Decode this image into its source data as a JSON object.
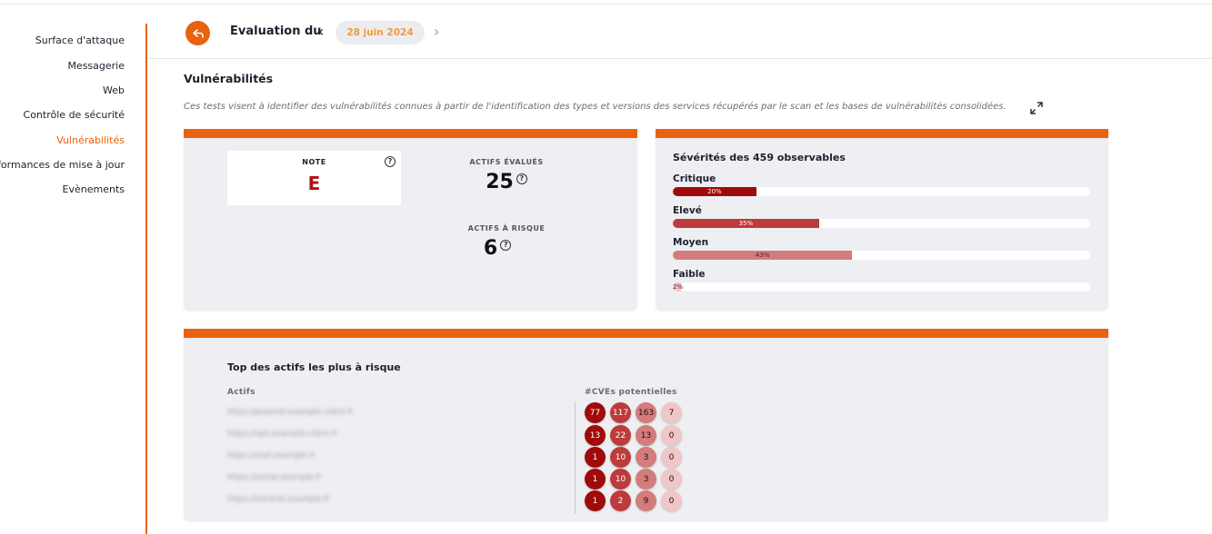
{
  "sidebar": {
    "items": [
      {
        "label": "Surface d'attaque",
        "active": false
      },
      {
        "label": "Messagerie",
        "active": false
      },
      {
        "label": "Web",
        "active": false
      },
      {
        "label": "Contrôle de sécurité",
        "active": false
      },
      {
        "label": "Vulnérabilités",
        "active": true
      },
      {
        "label": "Performances de mise à jour",
        "active": false
      },
      {
        "label": "Evènements",
        "active": false
      }
    ]
  },
  "header": {
    "back_icon": "share-arrow-icon",
    "evaluation_label": "Evaluation du",
    "date": "28 juin 2024",
    "prev_icon": "chevron-left-icon",
    "next_icon": "chevron-right-icon"
  },
  "section": {
    "title": "Vulnérabilités",
    "description": "Ces tests visent à identifier des vulnérabilités connues à partir de l'identification des types et versions des services récupérés par le scan et les bases de vulnérabilités consolidées.",
    "expand_icon": "expand-arrows-icon"
  },
  "summary": {
    "note_label": "NOTE",
    "note_value": "E",
    "actifs_evalues_label": "ACTIFS ÉVALUÉS",
    "actifs_evalues_value": "25",
    "actifs_risque_label": "ACTIFS À RISQUE",
    "actifs_risque_value": "6",
    "help_glyph": "?"
  },
  "severity": {
    "title": "Sévérités des 459 observables",
    "rows": [
      {
        "label": "Critique",
        "percent": 20,
        "percent_text": "20%",
        "color": "#a10a0a"
      },
      {
        "label": "Elevé",
        "percent": 35,
        "percent_text": "35%",
        "color": "#bd3b3b"
      },
      {
        "label": "Moyen",
        "percent": 43,
        "percent_text": "43%",
        "color": "#d27c7c"
      },
      {
        "label": "Faible",
        "percent": 2,
        "percent_text": "2%",
        "color": "#f0c6c6"
      }
    ]
  },
  "top_assets": {
    "title": "Top des actifs les plus à risque",
    "col_assets": "Actifs",
    "col_cves": "#CVEs potentielles",
    "rows": [
      {
        "asset": "https://preprod.example-client.fr",
        "cves": [
          "77",
          "117",
          "163",
          "7"
        ]
      },
      {
        "asset": "https://vpn.example-client.fr",
        "cves": [
          "13",
          "22",
          "13",
          "0"
        ]
      },
      {
        "asset": "https://mail.example.fr",
        "cves": [
          "1",
          "10",
          "3",
          "0"
        ]
      },
      {
        "asset": "https://portal.example.fr",
        "cves": [
          "1",
          "10",
          "3",
          "0"
        ]
      },
      {
        "asset": "https://intranet.example.fr",
        "cves": [
          "1",
          "2",
          "9",
          "0"
        ]
      }
    ]
  }
}
